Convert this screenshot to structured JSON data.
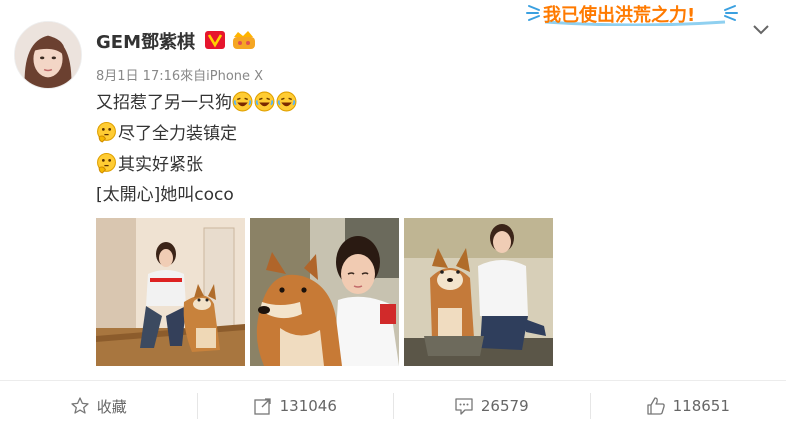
{
  "post": {
    "username": "GEM鄧紫棋",
    "meta": "8月1日 17:16來自iPhone X",
    "line1": "又招惹了另一只狗",
    "line2": "尽了全力装镇定",
    "line3": "其实好紧张",
    "line4": "[太開心]她叫coco"
  },
  "banner": {
    "text": "我已使出洪荒之力!"
  },
  "actions": {
    "favorite_label": "收藏",
    "repost_count": "131046",
    "comment_count": "26579",
    "like_count": "118651"
  },
  "icons": {
    "verified": "verified-v-badge",
    "vip": "vip-crown-badge",
    "laugh": "laughing-emoji",
    "thinking": "thinking-emoji",
    "favorite": "star-icon",
    "repost": "share-arrow-icon",
    "comment": "comment-icon",
    "like": "thumbs-up-icon",
    "expand": "chevron-down-icon"
  },
  "colors": {
    "accent": "#ff8200",
    "verified": "#e6162d",
    "text": "#333333",
    "muted": "#888888"
  }
}
